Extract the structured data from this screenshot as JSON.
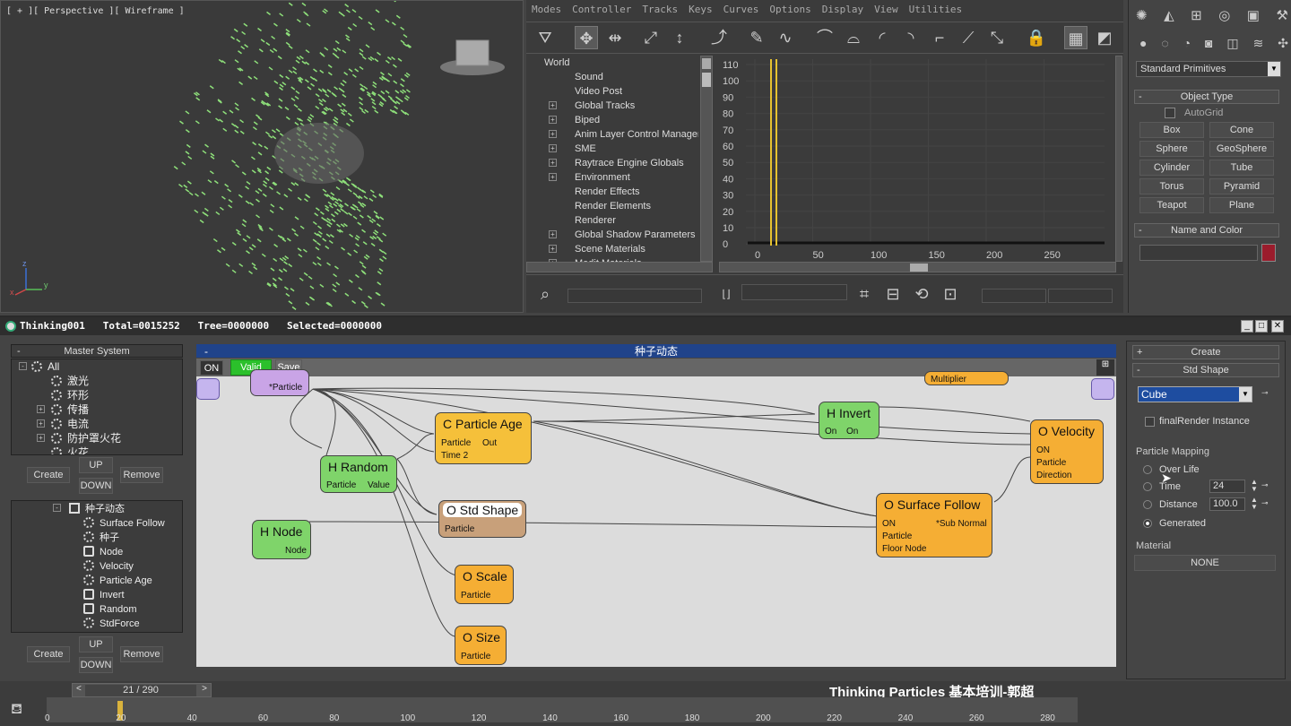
{
  "viewport": {
    "label": "[ + ][ Perspective ][ Wireframe ]",
    "axis_x": "x",
    "axis_y": "y",
    "axis_z": "z"
  },
  "trackview": {
    "menu": [
      "Modes",
      "Controller",
      "Tracks",
      "Keys",
      "Curves",
      "Options",
      "Display",
      "View",
      "Utilities"
    ],
    "tree": [
      {
        "label": "World",
        "plus": false,
        "indent": 0
      },
      {
        "label": "Sound",
        "plus": false,
        "indent": 1
      },
      {
        "label": "Video Post",
        "plus": false,
        "indent": 1
      },
      {
        "label": "Global Tracks",
        "plus": true,
        "indent": 1
      },
      {
        "label": "Biped",
        "plus": true,
        "indent": 1
      },
      {
        "label": "Anim Layer Control Manager",
        "plus": true,
        "indent": 1
      },
      {
        "label": "SME",
        "plus": true,
        "indent": 1
      },
      {
        "label": "Raytrace Engine Globals",
        "plus": true,
        "indent": 1
      },
      {
        "label": "Environment",
        "plus": true,
        "indent": 1
      },
      {
        "label": "Render Effects",
        "plus": false,
        "indent": 1
      },
      {
        "label": "Render Elements",
        "plus": false,
        "indent": 1
      },
      {
        "label": "Renderer",
        "plus": false,
        "indent": 1
      },
      {
        "label": "Global Shadow Parameters",
        "plus": true,
        "indent": 1
      },
      {
        "label": "Scene Materials",
        "plus": true,
        "indent": 1
      },
      {
        "label": "Medit Materials",
        "plus": true,
        "indent": 1
      }
    ],
    "y_ticks": [
      "110",
      "100",
      "90",
      "80",
      "70",
      "60",
      "50",
      "40",
      "30",
      "20",
      "10",
      "0"
    ],
    "x_ticks": [
      "0",
      "50",
      "100",
      "150",
      "200",
      "250"
    ]
  },
  "command_panel": {
    "dropdown": "Standard Primitives",
    "object_type_header": "Object Type",
    "autogrid": "AutoGrid",
    "buttons": [
      "Box",
      "Cone",
      "Sphere",
      "GeoSphere",
      "Cylinder",
      "Tube",
      "Torus",
      "Pyramid",
      "Teapot",
      "Plane"
    ],
    "name_color_header": "Name and Color",
    "swatch_color": "#9b1c2c"
  },
  "tp": {
    "title": "Thinking001   Total=0015252   Tree=0000000   Selected=0000000",
    "master_system": "Master System",
    "master_list": [
      {
        "label": "All",
        "plus": "minus",
        "indent": 0
      },
      {
        "label": "激光",
        "plus": "",
        "indent": 1
      },
      {
        "label": "环形",
        "plus": "",
        "indent": 1
      },
      {
        "label": "传播",
        "plus": "plus",
        "indent": 1
      },
      {
        "label": "电流",
        "plus": "plus",
        "indent": 1
      },
      {
        "label": "防护罩火花",
        "plus": "plus",
        "indent": 1
      },
      {
        "label": "火花",
        "plus": "",
        "indent": 1
      }
    ],
    "create": "Create",
    "up": "UP",
    "down": "DOWN",
    "remove": "Remove",
    "ops_header": "种子动态",
    "ops_list": [
      {
        "label": "种子动态",
        "kind": "group"
      },
      {
        "label": "Surface Follow",
        "kind": "gear"
      },
      {
        "label": "种子",
        "kind": "gear"
      },
      {
        "label": "Node",
        "kind": "helper"
      },
      {
        "label": "Velocity",
        "kind": "gear"
      },
      {
        "label": "Particle Age",
        "kind": "gear"
      },
      {
        "label": "Invert",
        "kind": "helper"
      },
      {
        "label": "Random",
        "kind": "helper"
      },
      {
        "label": "StdForce",
        "kind": "gear"
      }
    ],
    "canvas_title": "种子动态",
    "on": "ON",
    "valid": "Valid",
    "save": "Save",
    "nodes": {
      "top_particle": "*Particle",
      "multiplier": "Multiplier",
      "particle_age": {
        "title": "C Particle Age",
        "in1": "Particle",
        "out1": "Out",
        "in2": "Time 2"
      },
      "h_random": {
        "title": "H Random",
        "in": "Particle",
        "out": "Value"
      },
      "h_invert": {
        "title": "H Invert",
        "in": "On",
        "out": "On"
      },
      "std_shape": {
        "title": "O Std Shape",
        "in": "Particle"
      },
      "h_node": {
        "title": "H Node",
        "out": "Node"
      },
      "scale": {
        "title": "O Scale",
        "in": "Particle"
      },
      "size": {
        "title": "O Size",
        "in": "Particle"
      },
      "surface_follow": {
        "title": "O Surface Follow",
        "in1": "ON",
        "out1": "*Sub Normal",
        "in2": "Particle",
        "in3": "Floor Node"
      },
      "velocity": {
        "title": "O Velocity",
        "in1": "ON",
        "in2": "Particle",
        "in3": "Direction"
      }
    },
    "right": {
      "create": "Create",
      "std_shape": "Std Shape",
      "shape_select": "Cube",
      "final_render": "finalRender Instance",
      "mapping_label": "Particle Mapping",
      "over_life": "Over Life",
      "time": "Time",
      "time_val": "24",
      "distance": "Distance",
      "distance_val": "100.0",
      "generated": "Generated",
      "material_label": "Material",
      "material_val": "NONE"
    }
  },
  "timeline": {
    "frame": "21 / 290",
    "ticks": [
      "0",
      "20",
      "40",
      "60",
      "80",
      "100",
      "120",
      "140",
      "160",
      "180",
      "200",
      "220",
      "240",
      "260",
      "280"
    ],
    "watermark": "Thinking Particles 基本培训-郭超"
  }
}
